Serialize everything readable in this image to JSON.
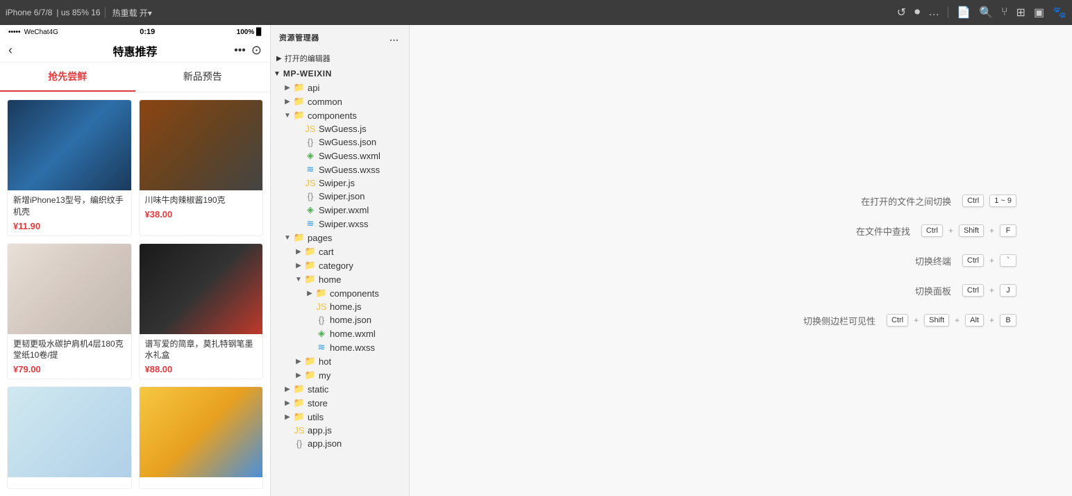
{
  "topbar": {
    "device": "iPhone 6/7/8",
    "scale": "85%",
    "scale_num": "16",
    "mode": "热重载 开▾",
    "icons": [
      "↺",
      "⏺",
      "…"
    ],
    "panel_icons": [
      "📄",
      "🔍",
      "🔀",
      "⬜",
      "☐",
      "🐾"
    ]
  },
  "phone": {
    "status": {
      "signal": "•••••",
      "carrier": "WeChat4G",
      "time": "0:19",
      "battery": "100%"
    },
    "nav_title": "特惠推荐",
    "nav_back": "‹",
    "tabs": [
      {
        "label": "抢先尝鲜",
        "active": true
      },
      {
        "label": "新品预告",
        "active": false
      }
    ],
    "products": [
      {
        "name": "新增iPhone13型号，编织纹手机壳",
        "price": "¥11.90",
        "img_class": "product-img-1"
      },
      {
        "name": "川味牛肉辣椒酱190克",
        "price": "¥38.00",
        "img_class": "product-img-2"
      },
      {
        "name": "更韧更吸水碳护肩机4层180克堂纸10卷/提",
        "price": "¥79.00",
        "img_class": "product-img-3"
      },
      {
        "name": "谱写爱的简章，莫扎特钢笔墨水礼盒",
        "price": "¥88.00",
        "img_class": "product-img-4"
      },
      {
        "name": "",
        "price": "",
        "img_class": "product-img-5"
      },
      {
        "name": "",
        "price": "",
        "img_class": "product-img-6"
      }
    ]
  },
  "explorer": {
    "title": "资源管理器",
    "opened_editors_label": "打开的编辑器",
    "project_name": "MP-WEIXIN",
    "tree": [
      {
        "type": "folder",
        "name": "api",
        "level": 1,
        "expanded": false,
        "icon": "folder"
      },
      {
        "type": "folder",
        "name": "common",
        "level": 1,
        "expanded": false,
        "icon": "folder"
      },
      {
        "type": "folder",
        "name": "components",
        "level": 1,
        "expanded": true,
        "icon": "folder-orange"
      },
      {
        "type": "file",
        "name": "SwGuess.js",
        "level": 2,
        "icon": "js"
      },
      {
        "type": "file",
        "name": "SwGuess.json",
        "level": 2,
        "icon": "json"
      },
      {
        "type": "file",
        "name": "SwGuess.wxml",
        "level": 2,
        "icon": "wxml"
      },
      {
        "type": "file",
        "name": "SwGuess.wxss",
        "level": 2,
        "icon": "wxss"
      },
      {
        "type": "file",
        "name": "Swiper.js",
        "level": 2,
        "icon": "js"
      },
      {
        "type": "file",
        "name": "Swiper.json",
        "level": 2,
        "icon": "json"
      },
      {
        "type": "file",
        "name": "Swiper.wxml",
        "level": 2,
        "icon": "wxml"
      },
      {
        "type": "file",
        "name": "Swiper.wxss",
        "level": 2,
        "icon": "wxss"
      },
      {
        "type": "folder",
        "name": "pages",
        "level": 1,
        "expanded": true,
        "icon": "folder-orange"
      },
      {
        "type": "folder",
        "name": "cart",
        "level": 2,
        "expanded": false,
        "icon": "folder"
      },
      {
        "type": "folder",
        "name": "category",
        "level": 2,
        "expanded": false,
        "icon": "folder"
      },
      {
        "type": "folder",
        "name": "home",
        "level": 2,
        "expanded": true,
        "icon": "folder"
      },
      {
        "type": "folder",
        "name": "components",
        "level": 3,
        "expanded": true,
        "icon": "folder-orange"
      },
      {
        "type": "file",
        "name": "home.js",
        "level": 3,
        "icon": "js"
      },
      {
        "type": "file",
        "name": "home.json",
        "level": 3,
        "icon": "json"
      },
      {
        "type": "file",
        "name": "home.wxml",
        "level": 3,
        "icon": "wxml"
      },
      {
        "type": "file",
        "name": "home.wxss",
        "level": 3,
        "icon": "wxss"
      },
      {
        "type": "folder",
        "name": "hot",
        "level": 2,
        "expanded": false,
        "icon": "folder"
      },
      {
        "type": "folder",
        "name": "my",
        "level": 2,
        "expanded": false,
        "icon": "folder"
      },
      {
        "type": "folder",
        "name": "static",
        "level": 1,
        "expanded": false,
        "icon": "folder"
      },
      {
        "type": "folder",
        "name": "store",
        "level": 1,
        "expanded": false,
        "icon": "folder"
      },
      {
        "type": "folder",
        "name": "utils",
        "level": 1,
        "expanded": false,
        "icon": "folder-orange"
      },
      {
        "type": "file",
        "name": "app.js",
        "level": 1,
        "icon": "js"
      },
      {
        "type": "file",
        "name": "app.json",
        "level": 1,
        "icon": "json"
      }
    ]
  },
  "shortcuts": [
    {
      "label": "在打开的文件之间切换",
      "keys": [
        "Ctrl",
        "1 ~ 9"
      ]
    },
    {
      "label": "在文件中查找",
      "keys": [
        "Ctrl",
        "+",
        "Shift",
        "+",
        "F"
      ]
    },
    {
      "label": "切换终端",
      "keys": [
        "Ctrl",
        "+",
        "`"
      ]
    },
    {
      "label": "切换面板",
      "keys": [
        "Ctrl",
        "+",
        "J"
      ]
    },
    {
      "label": "切换侧边栏可见性",
      "keys": [
        "Ctrl",
        "+",
        "Shift",
        "+",
        "Alt",
        "+",
        "B"
      ]
    }
  ]
}
